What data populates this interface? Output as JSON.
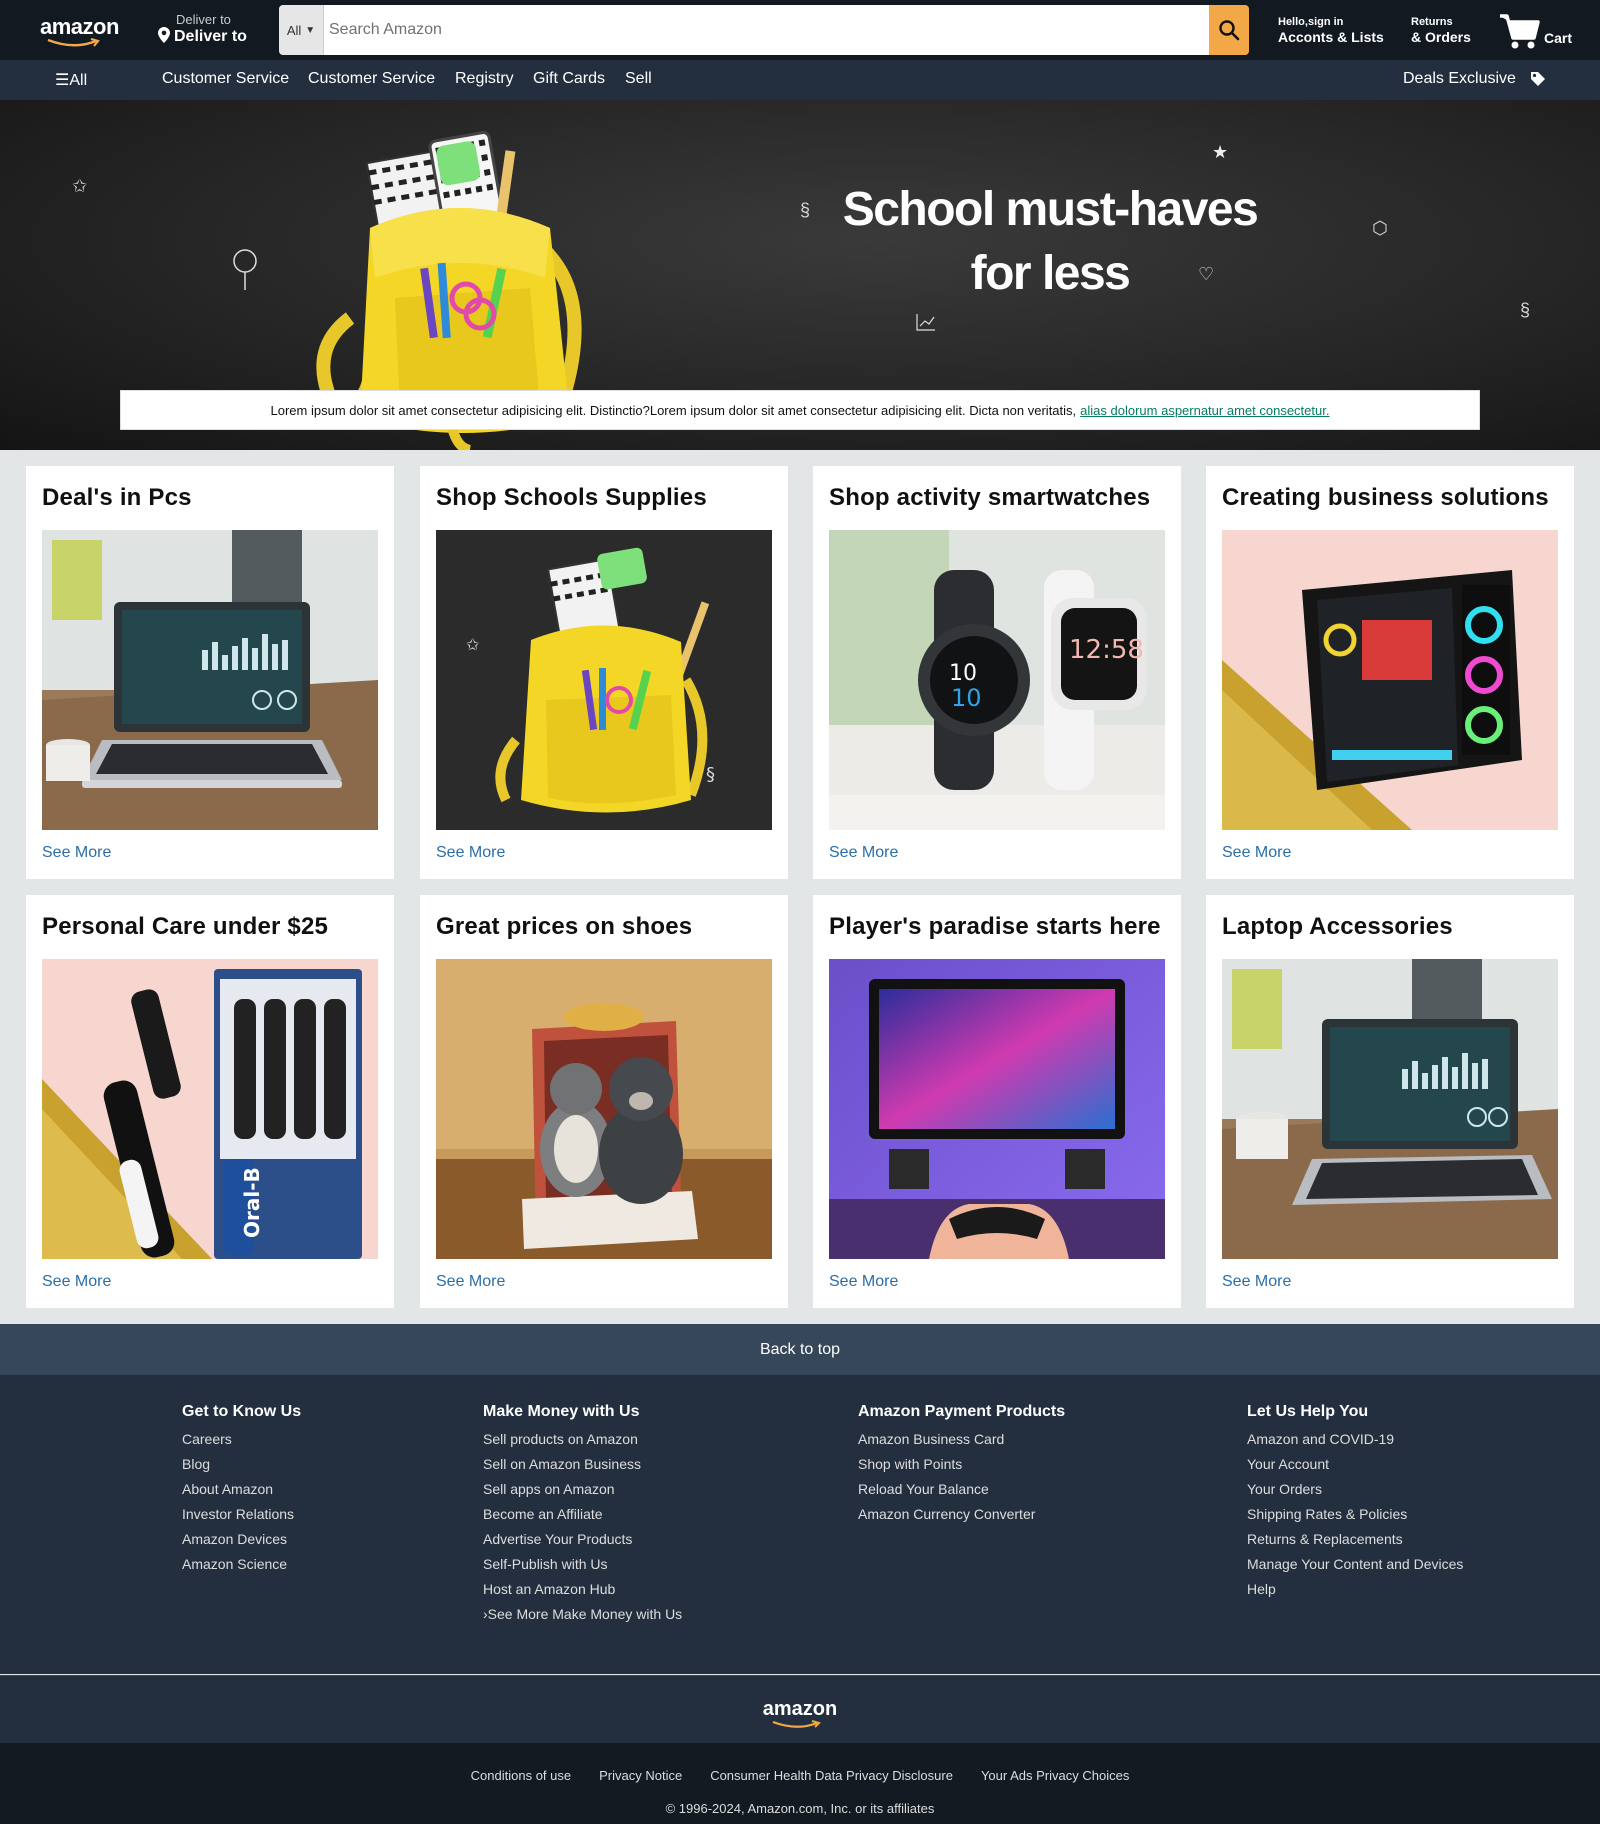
{
  "header": {
    "logo_text": "amazon",
    "deliver_line1": "Deliver to",
    "deliver_line2": "Deliver to",
    "search_category": "All",
    "search_placeholder": "Search Amazon",
    "account_line1": "Hello,sign in",
    "account_line2": "Acconts & Lists",
    "returns_line1": "Returns",
    "returns_line2": "& Orders",
    "cart_label": "Cart",
    "accent_color": "#f3a847"
  },
  "nav": {
    "all_label": "All",
    "items": [
      {
        "label": "Customer Service"
      },
      {
        "label": "Customer Service"
      },
      {
        "label": "Registry"
      },
      {
        "label": "Gift Cards"
      },
      {
        "label": "Sell"
      }
    ],
    "deals_label": "Deals Exclusive"
  },
  "hero": {
    "headline_line1": "School must-haves",
    "headline_line2": "for less",
    "notice_text": "Lorem ipsum dolor sit amet consectetur adipisicing elit. Distinctio?Lorem ipsum dolor sit amet consectetur adipisicing elit. Dicta non veritatis,",
    "notice_link": "alias dolorum aspernatur amet consectetur."
  },
  "cards": [
    {
      "title": "Deal's in Pcs",
      "image": "laptop",
      "link": "See More"
    },
    {
      "title": "Shop Schools Supplies",
      "image": "backpack",
      "link": "See More"
    },
    {
      "title": "Shop activity smartwatches",
      "image": "smartwatches",
      "link": "See More"
    },
    {
      "title": "Creating business solutions",
      "image": "pc-tower",
      "link": "See More"
    },
    {
      "title": "Personal Care under $25",
      "image": "toothbrushes",
      "link": "See More"
    },
    {
      "title": "Great prices on shoes",
      "image": "plush-toys-box",
      "link": "See More"
    },
    {
      "title": "Player's paradise starts here",
      "image": "gaming",
      "link": "See More"
    },
    {
      "title": "Laptop Accessories",
      "image": "laptop",
      "link": "See More"
    }
  ],
  "footer": {
    "back_to_top": "Back to top",
    "columns": [
      {
        "title": "Get to Know Us",
        "links": [
          "Careers",
          "Blog",
          "About Amazon",
          "Investor Relations",
          "Amazon Devices",
          "Amazon Science"
        ]
      },
      {
        "title": "Make Money with Us",
        "links": [
          "Sell products on Amazon",
          "Sell on Amazon Business",
          "Sell apps on Amazon",
          "Become an Affiliate",
          "Advertise Your Products",
          "Self-Publish with Us",
          "Host an Amazon Hub",
          "›See More Make Money with Us"
        ]
      },
      {
        "title": "Amazon Payment Products",
        "links": [
          "Amazon Business Card",
          "Shop with Points",
          "Reload Your Balance",
          "Amazon Currency Converter"
        ]
      },
      {
        "title": "Let Us Help You",
        "links": [
          "Amazon and COVID-19",
          "Your Account",
          "Your Orders",
          "Shipping Rates & Policies",
          "Returns & Replacements",
          "Manage Your Content and Devices",
          "Help"
        ]
      }
    ],
    "logo_text": "amazon",
    "bottom_links": [
      "Conditions of use",
      "Privacy Notice",
      "Consumer Health Data Privacy Disclosure",
      "Your Ads Privacy Choices"
    ],
    "copyright": "© 1996-2024, Amazon.com, Inc. or its affiliates"
  }
}
